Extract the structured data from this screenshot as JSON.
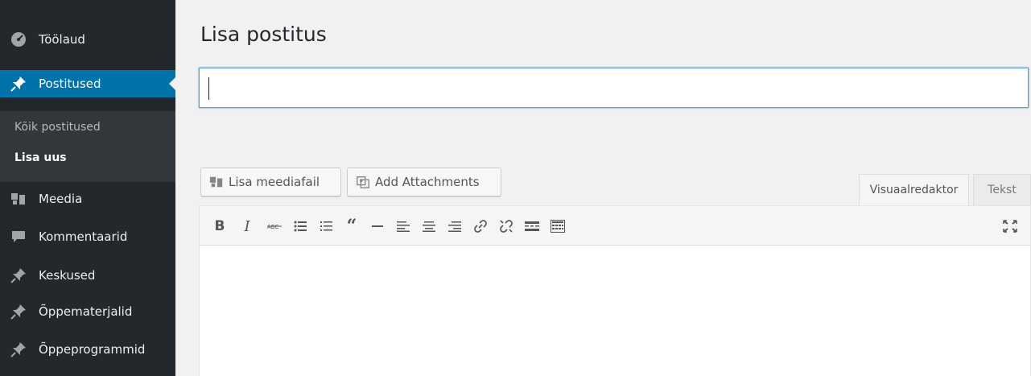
{
  "sidebar": {
    "items": [
      {
        "label": "Töölaud",
        "icon": "dashboard-icon"
      },
      {
        "label": "Postitused",
        "icon": "pin-icon"
      },
      {
        "label": "Meedia",
        "icon": "media-icon"
      },
      {
        "label": "Kommentaarid",
        "icon": "comment-icon"
      },
      {
        "label": "Keskused",
        "icon": "pin-icon"
      },
      {
        "label": "Õppematerjalid",
        "icon": "pin-icon"
      },
      {
        "label": "Õppeprogrammid",
        "icon": "pin-icon"
      }
    ],
    "submenu": [
      {
        "label": "Kõik postitused"
      },
      {
        "label": "Lisa uus"
      }
    ],
    "current_color": "#0073aa"
  },
  "main": {
    "title": "Lisa postitus",
    "title_input": {
      "value": ""
    },
    "buttons": {
      "add_media": "Lisa meediafail",
      "add_attachments": "Add Attachments"
    },
    "tabs": {
      "visual": "Visuaalredaktor",
      "text": "Tekst"
    },
    "toolbar": [
      "bold",
      "italic",
      "strikethrough",
      "bulleted-list",
      "numbered-list",
      "blockquote",
      "horizontal-line",
      "align-left",
      "align-center",
      "align-right",
      "insert-link",
      "remove-link",
      "read-more",
      "toolbar-toggle",
      "fullscreen"
    ]
  }
}
